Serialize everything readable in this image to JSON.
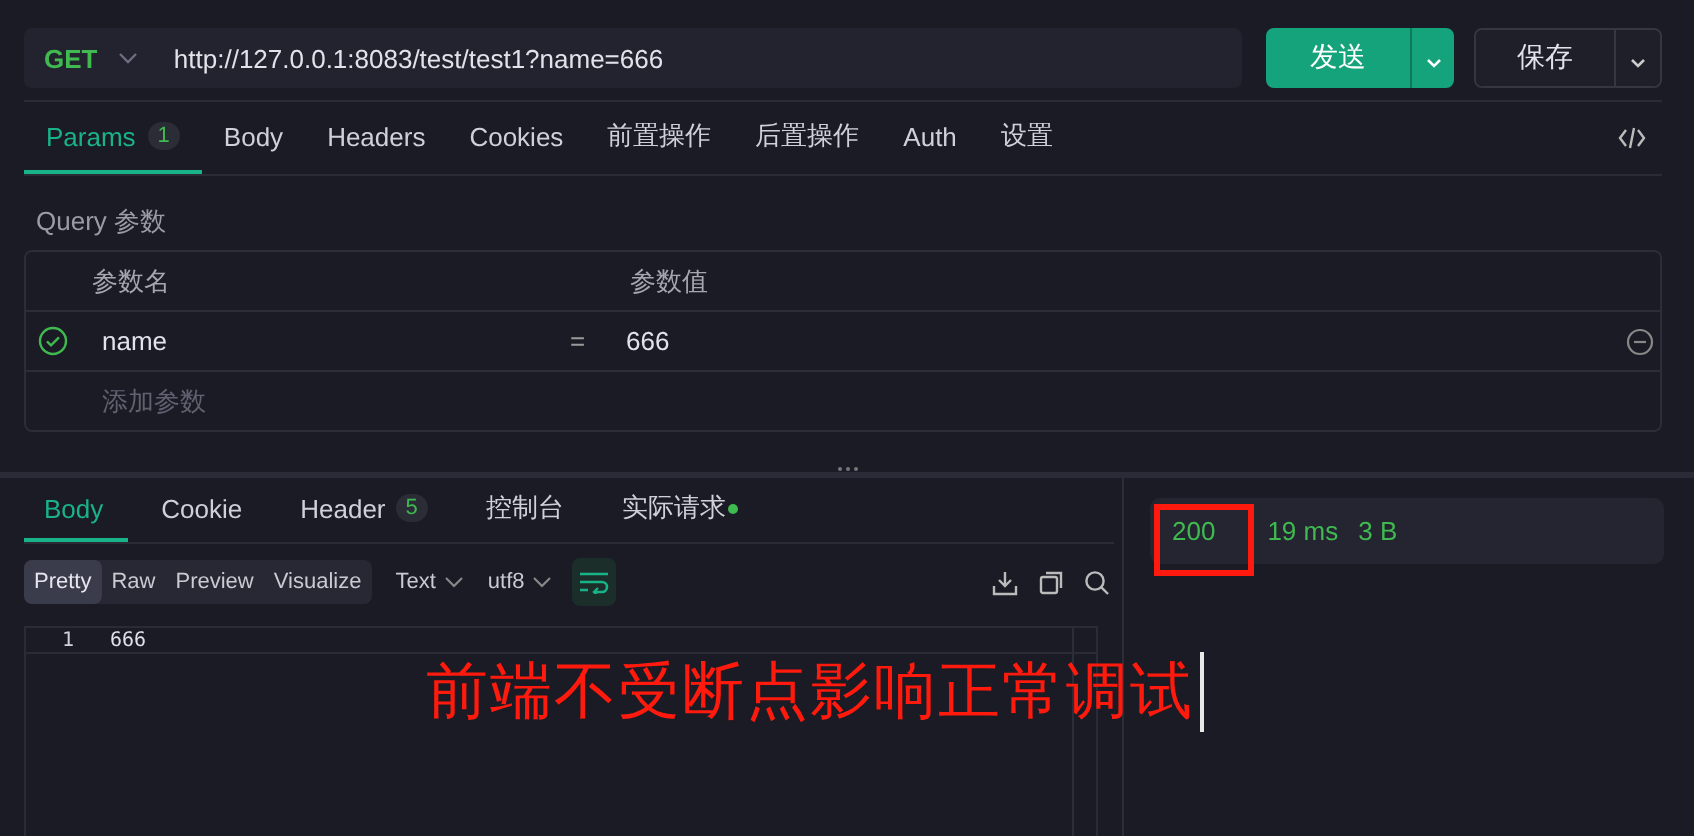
{
  "request": {
    "method": "GET",
    "url": "http://127.0.0.1:8083/test/test1?name=666",
    "send_label": "发送",
    "save_label": "保存"
  },
  "request_tabs": [
    {
      "label": "Params",
      "badge": "1",
      "selected": true
    },
    {
      "label": "Body",
      "selected": false
    },
    {
      "label": "Headers",
      "selected": false
    },
    {
      "label": "Cookies",
      "selected": false
    },
    {
      "label": "前置操作",
      "selected": false
    },
    {
      "label": "后置操作",
      "selected": false
    },
    {
      "label": "Auth",
      "selected": false
    },
    {
      "label": "设置",
      "selected": false
    }
  ],
  "query": {
    "title": "Query 参数",
    "columns": [
      "参数名",
      "参数值"
    ],
    "rows": [
      {
        "enabled": true,
        "name": "name",
        "operator": "=",
        "value": "666"
      }
    ],
    "add_placeholder": "添加参数"
  },
  "response_tabs": [
    {
      "label": "Body",
      "selected": true
    },
    {
      "label": "Cookie",
      "selected": false
    },
    {
      "label": "Header",
      "badge": "5",
      "selected": false
    },
    {
      "label": "控制台",
      "selected": false
    },
    {
      "label": "实际请求",
      "dot": true,
      "selected": false
    }
  ],
  "view_modes": [
    {
      "label": "Pretty",
      "selected": true
    },
    {
      "label": "Raw",
      "selected": false
    },
    {
      "label": "Preview",
      "selected": false
    },
    {
      "label": "Visualize",
      "selected": false
    }
  ],
  "format": "Text",
  "encoding": "utf8",
  "word_wrap": true,
  "body_lines": [
    {
      "number": "1",
      "text": "666"
    }
  ],
  "status": {
    "code": "200",
    "time": "19 ms",
    "size": "3 B"
  },
  "annotation": {
    "text": "前端不受断点影响正常调试"
  }
}
